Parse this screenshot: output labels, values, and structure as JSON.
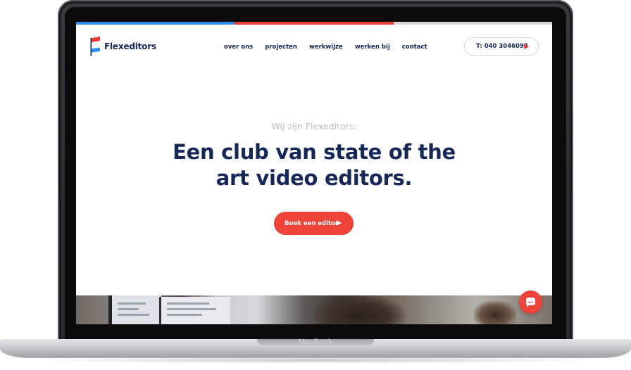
{
  "device": {
    "brand_label": "MacBook"
  },
  "colors": {
    "navy": "#16275a",
    "accent_red": "#ef4238",
    "stripe_blue": "#2f8ff0",
    "stripe_red": "#ee3b34",
    "stripe_grey": "#d4d6db",
    "muted_text": "#b9bcc4"
  },
  "header": {
    "logo_text": "Flexeditors",
    "nav": [
      {
        "label": "over ons"
      },
      {
        "label": "projecten"
      },
      {
        "label": "werkwijze"
      },
      {
        "label": "werken bij"
      },
      {
        "label": "contact"
      }
    ],
    "phone_label": "T: 040 3046092",
    "phone_icon": "play-icon"
  },
  "hero": {
    "eyebrow": "Wij zijn Flexeditors:",
    "headline_line1": "Een club van state of the",
    "headline_line2": "art video editors.",
    "cta_label": "Boek een editor",
    "cta_icon": "play-icon"
  },
  "chat": {
    "icon": "chat-bubble-icon"
  }
}
